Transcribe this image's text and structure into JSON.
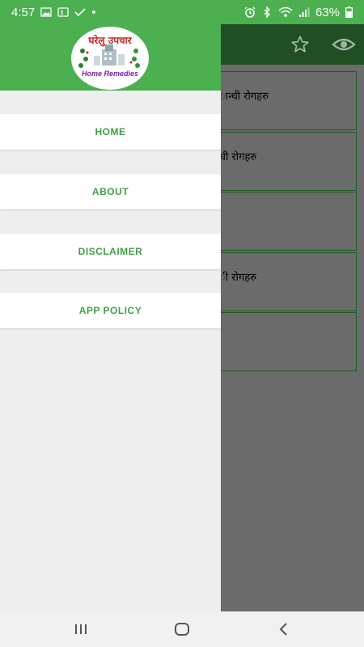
{
  "status_bar": {
    "time": "4:57",
    "battery": "63%",
    "dot": "•",
    "left_icons": [
      "image-icon",
      "assistant-icon",
      "check-icon"
    ],
    "right_icons": [
      "alarm-icon",
      "bluetooth-icon",
      "wifi-icon",
      "signal-icon",
      "battery-icon"
    ]
  },
  "drawer": {
    "logo": {
      "title": "घरेलु उपचार",
      "subtitle": "Home Remedies"
    },
    "menu": [
      {
        "label": "HOME"
      },
      {
        "label": "ABOUT"
      },
      {
        "label": "DISCLAIMER"
      },
      {
        "label": "APP POLICY"
      }
    ]
  },
  "background": {
    "toolbar_icons": [
      "star-icon",
      "eye-icon"
    ],
    "cards": [
      {
        "text": "ान्धी रोगहरु"
      },
      {
        "text": "धी रोगहरु"
      },
      {
        "text": ""
      },
      {
        "text": "ी रोगहरु"
      },
      {
        "text": ""
      }
    ]
  },
  "colors": {
    "primary": "#4caf50",
    "primary_dark": "#1f4f22",
    "accent_text": "#43a047",
    "scrim": "#6b6b6b"
  },
  "nav_bar": {
    "icons": [
      "recents-icon",
      "home-icon",
      "back-icon"
    ]
  }
}
